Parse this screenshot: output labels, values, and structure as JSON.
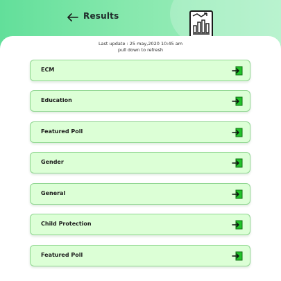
{
  "header": {
    "title": "Results",
    "back_icon": "arrow-left-icon",
    "illustration_icon": "report-chart-icon"
  },
  "update": {
    "last_update": "Last update : 25 may,2020 10:45 am",
    "hint": "pull down to refresh"
  },
  "items": [
    {
      "label": "ECM",
      "icon": "enter-icon"
    },
    {
      "label": "Education",
      "icon": "enter-icon"
    },
    {
      "label": "Featured Poll",
      "icon": "enter-icon"
    },
    {
      "label": "Gender",
      "icon": "enter-icon"
    },
    {
      "label": "General",
      "icon": "enter-icon"
    },
    {
      "label": "Child Protection",
      "icon": "enter-icon"
    },
    {
      "label": "Featured Poll",
      "icon": "enter-icon"
    }
  ],
  "colors": {
    "header_start": "#62df9a",
    "header_end": "#a6f0c2",
    "card_bg": "#dcffd6",
    "card_border": "#8fd690",
    "icon_green": "#22c22a"
  }
}
